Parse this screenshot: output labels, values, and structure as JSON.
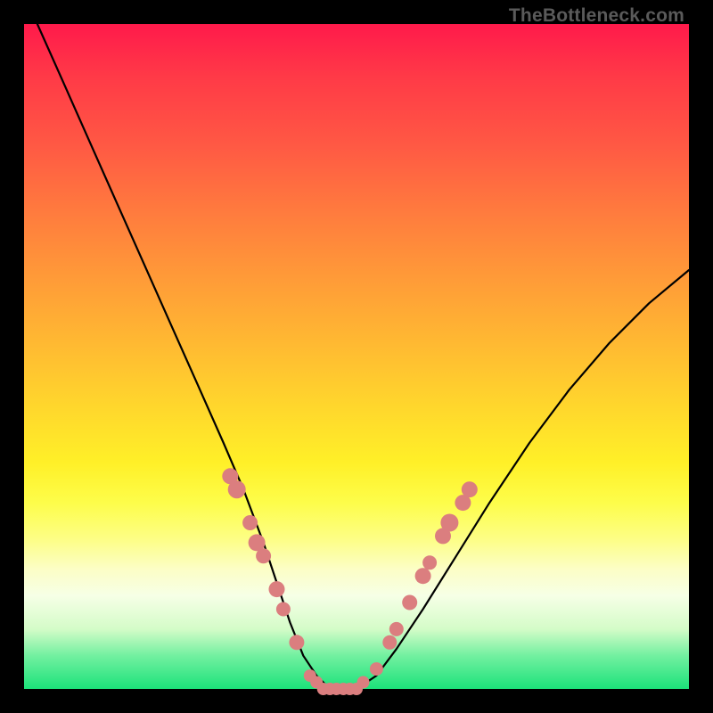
{
  "watermark": "TheBottleneck.com",
  "colors": {
    "frame": "#000000",
    "watermark": "#5a5a5a",
    "curve": "#000000",
    "marker_fill": "#db7e7f",
    "marker_stroke": "#c86a6b"
  },
  "chart_data": {
    "type": "line",
    "title": "",
    "xlabel": "",
    "ylabel": "",
    "xlim": [
      0,
      100
    ],
    "ylim": [
      0,
      100
    ],
    "grid": false,
    "series": [
      {
        "name": "bottleneck-curve",
        "x": [
          2,
          6,
          10,
          14,
          18,
          22,
          26,
          30,
          33,
          36,
          38,
          40,
          42,
          44,
          46,
          48,
          50,
          53,
          56,
          60,
          65,
          70,
          76,
          82,
          88,
          94,
          100
        ],
        "y": [
          100,
          91,
          82,
          73,
          64,
          55,
          46,
          37,
          30,
          22,
          16,
          10,
          5,
          2,
          0,
          0,
          0,
          2,
          6,
          12,
          20,
          28,
          37,
          45,
          52,
          58,
          63
        ]
      }
    ],
    "markers": [
      {
        "x": 31,
        "y": 32,
        "r": 1.8
      },
      {
        "x": 32,
        "y": 30,
        "r": 2.0
      },
      {
        "x": 34,
        "y": 25,
        "r": 1.7
      },
      {
        "x": 35,
        "y": 22,
        "r": 1.9
      },
      {
        "x": 36,
        "y": 20,
        "r": 1.7
      },
      {
        "x": 38,
        "y": 15,
        "r": 1.8
      },
      {
        "x": 39,
        "y": 12,
        "r": 1.6
      },
      {
        "x": 41,
        "y": 7,
        "r": 1.7
      },
      {
        "x": 43,
        "y": 2,
        "r": 1.4
      },
      {
        "x": 44,
        "y": 1,
        "r": 1.4
      },
      {
        "x": 45,
        "y": 0,
        "r": 1.4
      },
      {
        "x": 46,
        "y": 0,
        "r": 1.4
      },
      {
        "x": 47,
        "y": 0,
        "r": 1.4
      },
      {
        "x": 48,
        "y": 0,
        "r": 1.4
      },
      {
        "x": 49,
        "y": 0,
        "r": 1.4
      },
      {
        "x": 50,
        "y": 0,
        "r": 1.4
      },
      {
        "x": 51,
        "y": 1,
        "r": 1.4
      },
      {
        "x": 53,
        "y": 3,
        "r": 1.5
      },
      {
        "x": 55,
        "y": 7,
        "r": 1.6
      },
      {
        "x": 56,
        "y": 9,
        "r": 1.6
      },
      {
        "x": 58,
        "y": 13,
        "r": 1.7
      },
      {
        "x": 60,
        "y": 17,
        "r": 1.8
      },
      {
        "x": 61,
        "y": 19,
        "r": 1.6
      },
      {
        "x": 63,
        "y": 23,
        "r": 1.8
      },
      {
        "x": 64,
        "y": 25,
        "r": 2.0
      },
      {
        "x": 66,
        "y": 28,
        "r": 1.8
      },
      {
        "x": 67,
        "y": 30,
        "r": 1.8
      }
    ]
  }
}
